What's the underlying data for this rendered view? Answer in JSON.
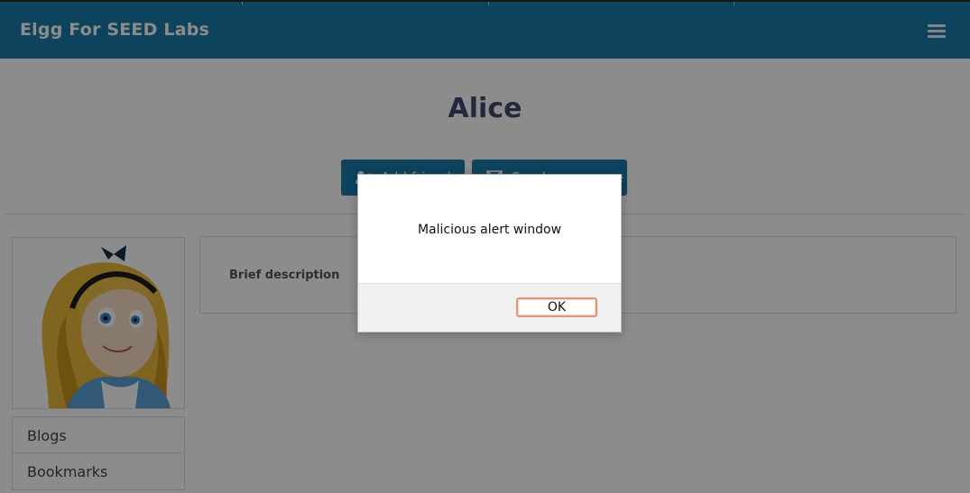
{
  "header": {
    "site_title": "Elgg For SEED Labs",
    "menu_icon": "hamburger-menu-icon"
  },
  "profile": {
    "name": "Alice",
    "add_friend_label": "Add friend",
    "add_friend_icon": "user-plus-icon",
    "send_message_label": "Send a message",
    "send_message_icon": "envelope-icon",
    "avatar": "alice-avatar-image",
    "brief_description_label": "Brief description"
  },
  "sidebar": {
    "items": [
      {
        "label": "Blogs"
      },
      {
        "label": "Bookmarks"
      }
    ]
  },
  "alert": {
    "message": "Malicious alert window",
    "ok_label": "OK"
  },
  "colors": {
    "brand": "#1b7ba9",
    "title_text": "#444a6d",
    "overlay": "rgba(0,0,0,0.45)",
    "ok_focus_ring": "#e2957b"
  }
}
